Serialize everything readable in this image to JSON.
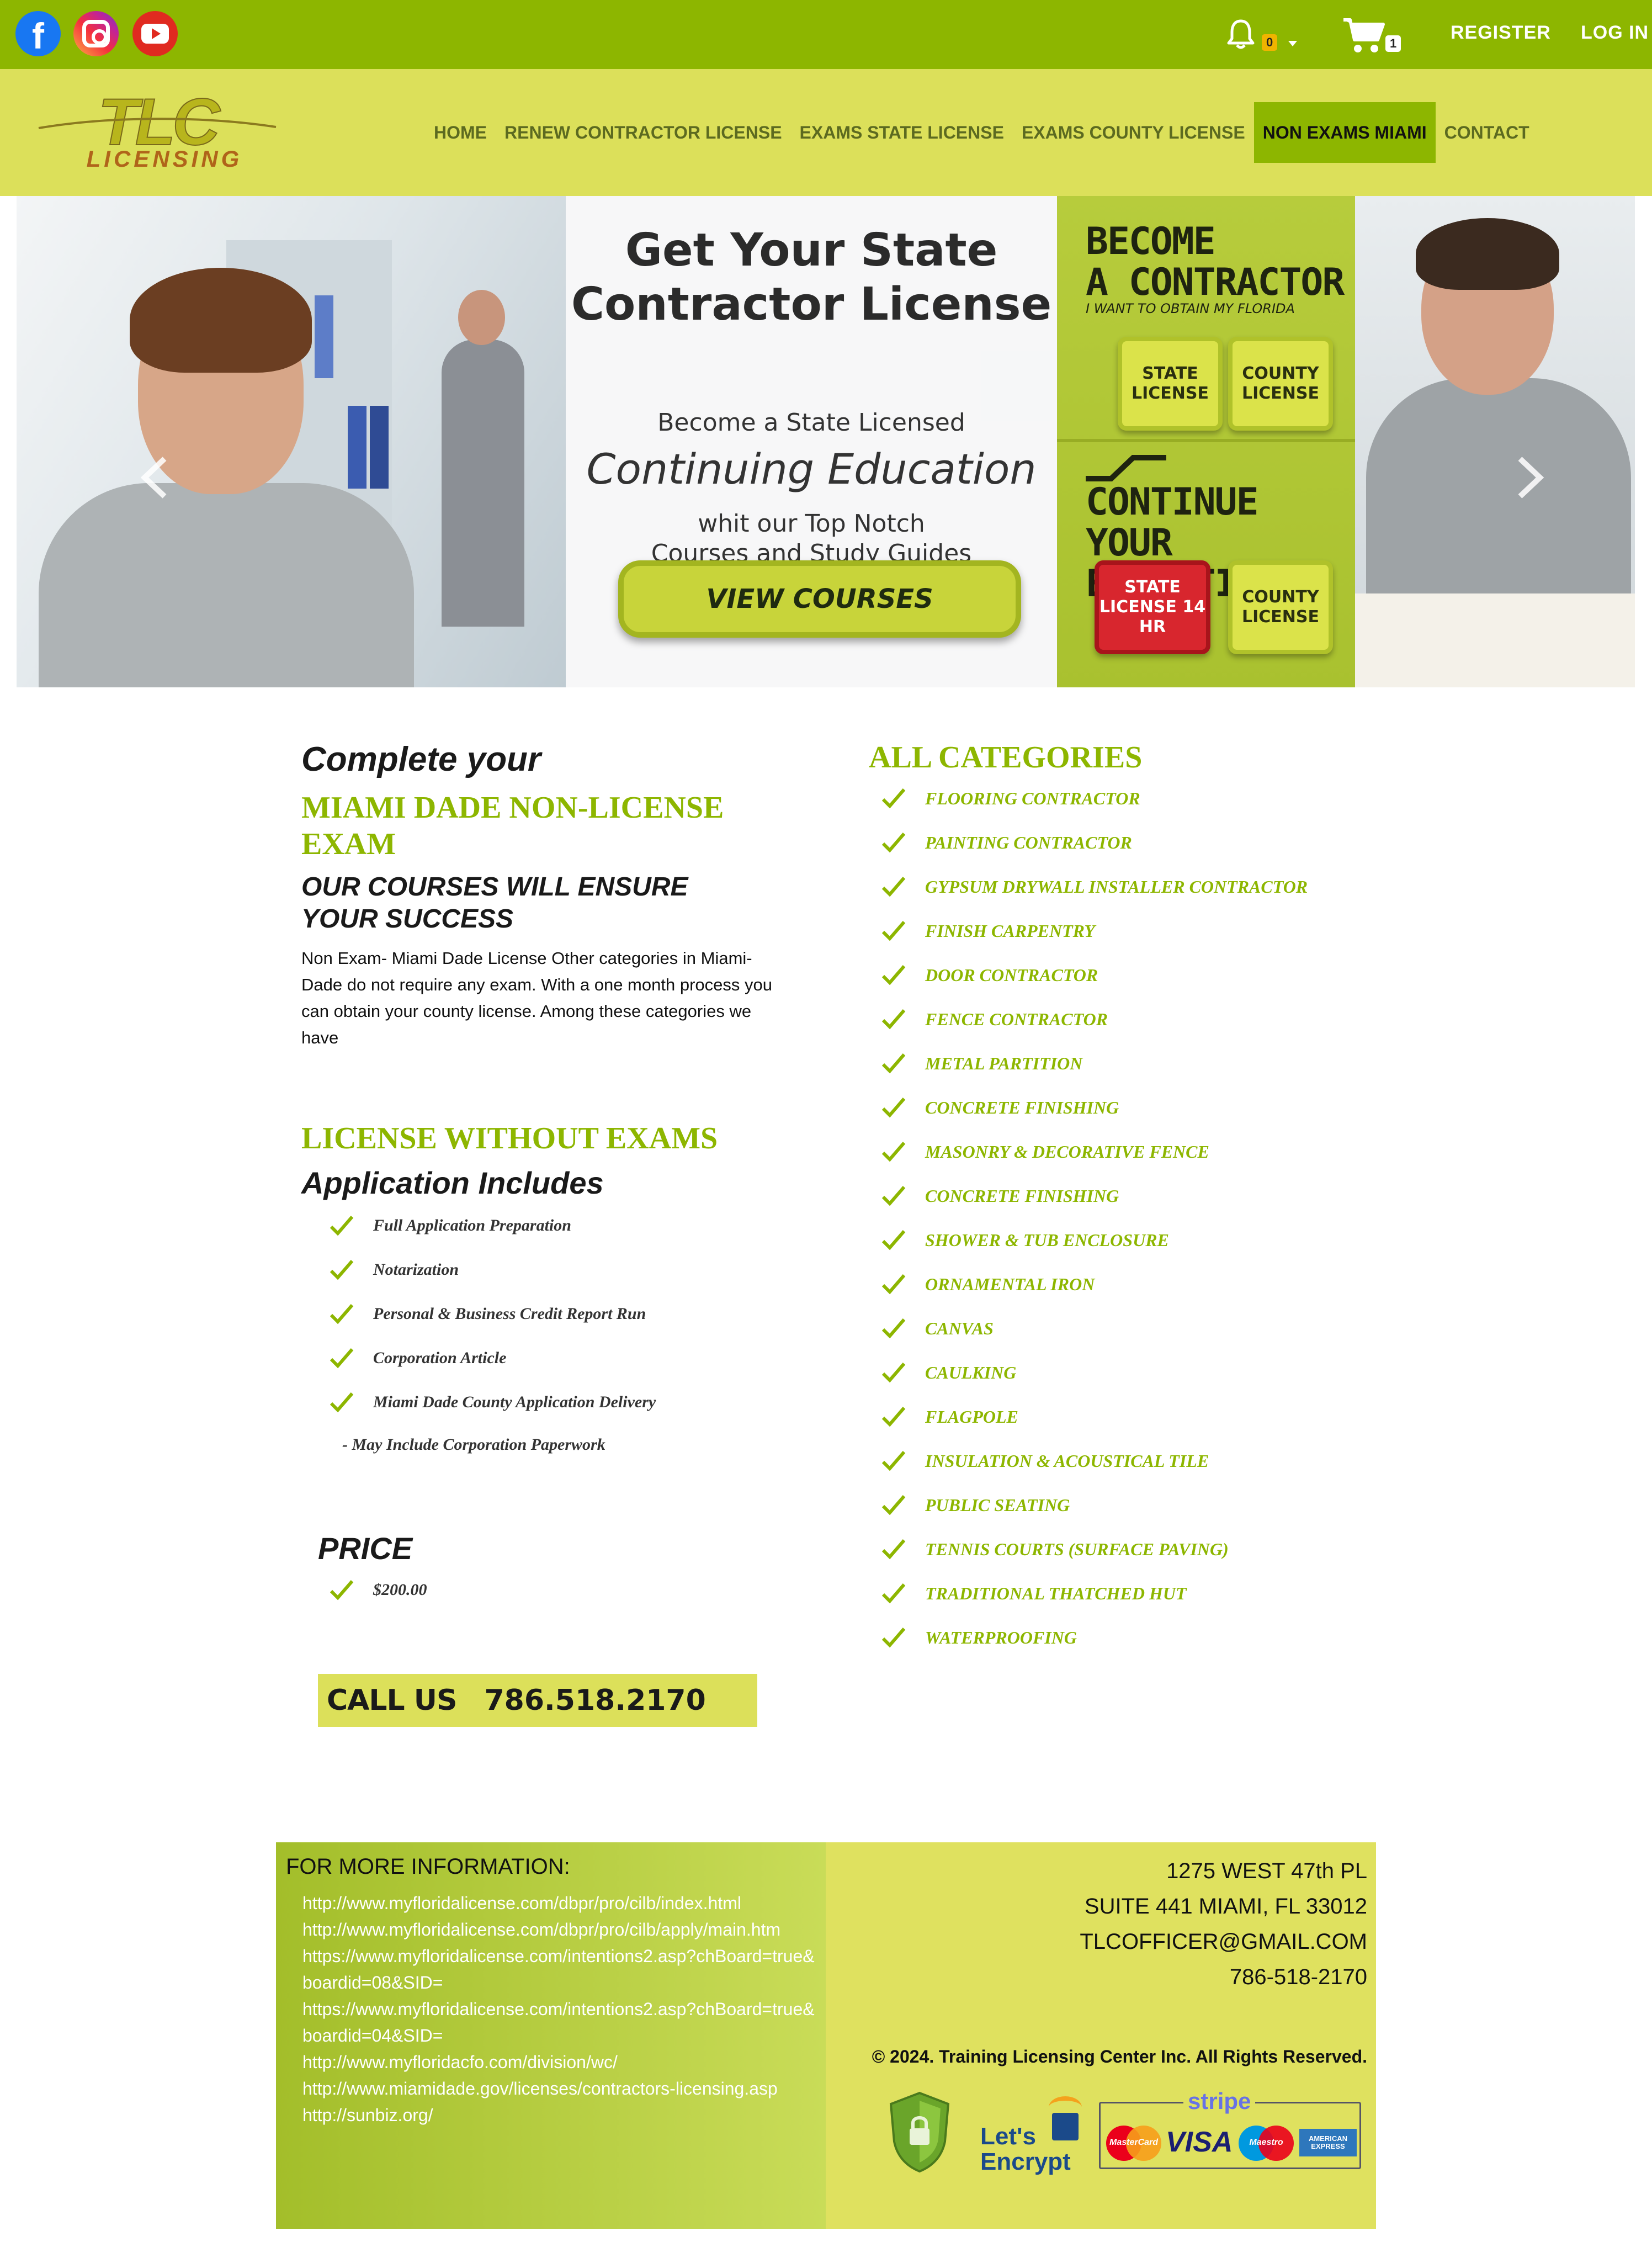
{
  "topbar": {
    "social": [
      {
        "name": "facebook",
        "icon": "facebook-icon"
      },
      {
        "name": "instagram",
        "icon": "instagram-icon"
      },
      {
        "name": "youtube",
        "icon": "youtube-icon"
      }
    ],
    "notifications_count": "0",
    "cart_count": "1",
    "register_label": "REGISTER",
    "login_label": "LOG IN",
    "bg_color": "#8db600"
  },
  "header": {
    "logo_text_main": "TLC",
    "logo_text_sub": "LICENSING",
    "nav": [
      {
        "label": "HOME",
        "active": false
      },
      {
        "label": "RENEW CONTRACTOR LICENSE",
        "active": false
      },
      {
        "label": "EXAMS STATE LICENSE",
        "active": false
      },
      {
        "label": "EXAMS COUNTY LICENSE",
        "active": false
      },
      {
        "label": "NON EXAMS MIAMI",
        "active": true
      },
      {
        "label": "CONTACT",
        "active": false
      }
    ],
    "bg_color": "#dce05a"
  },
  "hero": {
    "title": "Get Your State Contractor License",
    "sub1": "Become a State Licensed",
    "script": "Continuing Education",
    "sub2a": "whit our Top Notch",
    "sub2b": "Courses and Study Guides",
    "button": "VIEW COURSES",
    "panel": {
      "become_1": "BECOME",
      "become_2": "A CONTRACTOR",
      "become_sub": "I WANT TO OBTAIN MY FLORIDA",
      "btn_state": "STATE LICENSE",
      "btn_county": "COUNTY LICENSE",
      "continue_1": "CONTINUE",
      "continue_2": "YOUR EDUCATION",
      "btn_state_14": "STATE LICENSE 14 HR",
      "btn_county_2": "COUNTY LICENSE"
    }
  },
  "content": {
    "complete": "Complete your",
    "exam_title": "MIAMI DADE NON-LICENSE EXAM",
    "ensure": "OUR COURSES WILL ENSURE YOUR SUCCESS",
    "description": "Non Exam- Miami Dade License Other categories in Miami-Dade do not require any exam. With a one month process you can obtain your county license. Among these categories we have",
    "license_without_exams": "LICENSE WITHOUT EXAMS",
    "application_includes": "Application Includes",
    "includes": [
      "Full Application Preparation",
      "Notarization",
      "Personal & Business Credit Report Run",
      "Corporation Article",
      "Miami Dade County Application Delivery"
    ],
    "note": "- May Include Corporation Paperwork",
    "price_heading": "PRICE",
    "price": "$200.00",
    "call_label": "CALL US",
    "call_number": "786.518.2170",
    "all_categories": "ALL CATEGORIES",
    "categories": [
      "FLOORING CONTRACTOR",
      "PAINTING CONTRACTOR",
      "GYPSUM DRYWALL INSTALLER CONTRACTOR",
      "FINISH CARPENTRY",
      "DOOR CONTRACTOR",
      "FENCE CONTRACTOR",
      "METAL PARTITION",
      "CONCRETE FINISHING",
      "MASONRY & DECORATIVE FENCE",
      "CONCRETE FINISHING",
      "SHOWER & TUB ENCLOSURE",
      "ORNAMENTAL IRON",
      "CANVAS",
      "CAULKING",
      "FLAGPOLE",
      "INSULATION & ACOUSTICAL TILE",
      "PUBLIC SEATING",
      "TENNIS COURTS (SURFACE PAVING)",
      "TRADITIONAL THATCHED HUT",
      "WATERPROOFING"
    ],
    "accent_color": "#8db600"
  },
  "footer": {
    "more_info": "FOR MORE INFORMATION:",
    "links": [
      "http://www.myfloridalicense.com/dbpr/pro/cilb/index.html",
      "http://www.myfloridalicense.com/dbpr/pro/cilb/apply/main.htm",
      "https://www.myfloridalicense.com/intentions2.asp?chBoard=true&boardid=08&SID=",
      "https://www.myfloridalicense.com/intentions2.asp?chBoard=true&boardid=04&SID=",
      "http://www.myfloridacfo.com/division/wc/",
      "http://www.miamidade.gov/licenses/contractors-licensing.asp",
      "http://sunbiz.org/"
    ],
    "address_1": "1275 WEST 47th PL",
    "address_2": "SUITE 441 MIAMI, FL 33012",
    "email": "TLCOFFICER@GMAIL.COM",
    "phone": "786-518-2170",
    "copyright": "© 2024. Training Licensing Center Inc. All Rights Reserved.",
    "lets_encrypt_1": "Let's",
    "lets_encrypt_2": "Encrypt",
    "stripe": "stripe",
    "card_mastercard": "MasterCard",
    "card_visa": "VISA",
    "card_maestro": "Maestro",
    "card_amex": "AMERICAN EXPRESS"
  }
}
